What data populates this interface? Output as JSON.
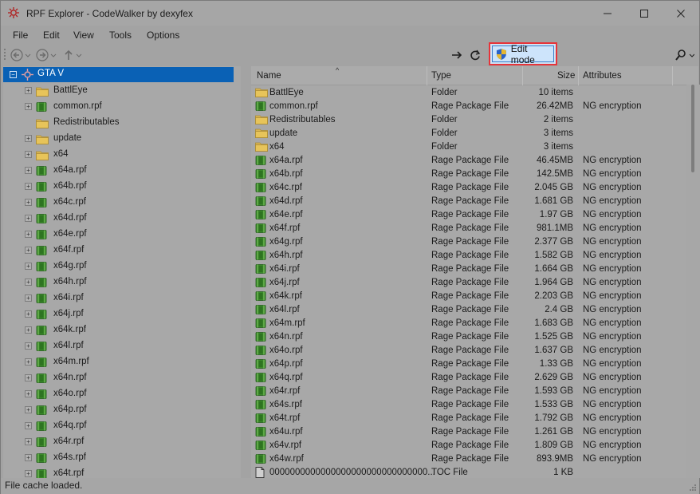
{
  "window": {
    "title": "RPF Explorer - CodeWalker by dexyfex",
    "minimize_icon": "minimize-icon",
    "maximize_icon": "maximize-icon",
    "close_icon": "close-icon"
  },
  "menu": {
    "items": [
      "File",
      "Edit",
      "View",
      "Tools",
      "Options"
    ]
  },
  "toolbar": {
    "edit_mode_label": "Edit mode"
  },
  "tree": {
    "root": "GTA V",
    "items": [
      {
        "label": "BattlEye",
        "type": "folder",
        "expandable": true
      },
      {
        "label": "common.rpf",
        "type": "rpf",
        "expandable": true
      },
      {
        "label": "Redistributables",
        "type": "folder",
        "expandable": false
      },
      {
        "label": "update",
        "type": "folder",
        "expandable": true
      },
      {
        "label": "x64",
        "type": "folder",
        "expandable": true
      },
      {
        "label": "x64a.rpf",
        "type": "rpf",
        "expandable": true
      },
      {
        "label": "x64b.rpf",
        "type": "rpf",
        "expandable": true
      },
      {
        "label": "x64c.rpf",
        "type": "rpf",
        "expandable": true
      },
      {
        "label": "x64d.rpf",
        "type": "rpf",
        "expandable": true
      },
      {
        "label": "x64e.rpf",
        "type": "rpf",
        "expandable": true
      },
      {
        "label": "x64f.rpf",
        "type": "rpf",
        "expandable": true
      },
      {
        "label": "x64g.rpf",
        "type": "rpf",
        "expandable": true
      },
      {
        "label": "x64h.rpf",
        "type": "rpf",
        "expandable": true
      },
      {
        "label": "x64i.rpf",
        "type": "rpf",
        "expandable": true
      },
      {
        "label": "x64j.rpf",
        "type": "rpf",
        "expandable": true
      },
      {
        "label": "x64k.rpf",
        "type": "rpf",
        "expandable": true
      },
      {
        "label": "x64l.rpf",
        "type": "rpf",
        "expandable": true
      },
      {
        "label": "x64m.rpf",
        "type": "rpf",
        "expandable": true
      },
      {
        "label": "x64n.rpf",
        "type": "rpf",
        "expandable": true
      },
      {
        "label": "x64o.rpf",
        "type": "rpf",
        "expandable": true
      },
      {
        "label": "x64p.rpf",
        "type": "rpf",
        "expandable": true
      },
      {
        "label": "x64q.rpf",
        "type": "rpf",
        "expandable": true
      },
      {
        "label": "x64r.rpf",
        "type": "rpf",
        "expandable": true
      },
      {
        "label": "x64s.rpf",
        "type": "rpf",
        "expandable": true
      },
      {
        "label": "x64t.rpf",
        "type": "rpf",
        "expandable": true
      }
    ]
  },
  "list": {
    "columns": [
      "Name",
      "Type",
      "Size",
      "Attributes"
    ],
    "rows": [
      {
        "name": "BattlEye",
        "type": "Folder",
        "size": "10 items",
        "attr": "",
        "icon": "folder"
      },
      {
        "name": "common.rpf",
        "type": "Rage Package File",
        "size": "26.42MB",
        "attr": "NG encryption",
        "icon": "rpf"
      },
      {
        "name": "Redistributables",
        "type": "Folder",
        "size": "2 items",
        "attr": "",
        "icon": "folder"
      },
      {
        "name": "update",
        "type": "Folder",
        "size": "3 items",
        "attr": "",
        "icon": "folder"
      },
      {
        "name": "x64",
        "type": "Folder",
        "size": "3 items",
        "attr": "",
        "icon": "folder"
      },
      {
        "name": "x64a.rpf",
        "type": "Rage Package File",
        "size": "46.45MB",
        "attr": "NG encryption",
        "icon": "rpf"
      },
      {
        "name": "x64b.rpf",
        "type": "Rage Package File",
        "size": "142.5MB",
        "attr": "NG encryption",
        "icon": "rpf"
      },
      {
        "name": "x64c.rpf",
        "type": "Rage Package File",
        "size": "2.045 GB",
        "attr": "NG encryption",
        "icon": "rpf"
      },
      {
        "name": "x64d.rpf",
        "type": "Rage Package File",
        "size": "1.681 GB",
        "attr": "NG encryption",
        "icon": "rpf"
      },
      {
        "name": "x64e.rpf",
        "type": "Rage Package File",
        "size": "1.97 GB",
        "attr": "NG encryption",
        "icon": "rpf"
      },
      {
        "name": "x64f.rpf",
        "type": "Rage Package File",
        "size": "981.1MB",
        "attr": "NG encryption",
        "icon": "rpf"
      },
      {
        "name": "x64g.rpf",
        "type": "Rage Package File",
        "size": "2.377 GB",
        "attr": "NG encryption",
        "icon": "rpf"
      },
      {
        "name": "x64h.rpf",
        "type": "Rage Package File",
        "size": "1.582 GB",
        "attr": "NG encryption",
        "icon": "rpf"
      },
      {
        "name": "x64i.rpf",
        "type": "Rage Package File",
        "size": "1.664 GB",
        "attr": "NG encryption",
        "icon": "rpf"
      },
      {
        "name": "x64j.rpf",
        "type": "Rage Package File",
        "size": "1.964 GB",
        "attr": "NG encryption",
        "icon": "rpf"
      },
      {
        "name": "x64k.rpf",
        "type": "Rage Package File",
        "size": "2.203 GB",
        "attr": "NG encryption",
        "icon": "rpf"
      },
      {
        "name": "x64l.rpf",
        "type": "Rage Package File",
        "size": "2.4 GB",
        "attr": "NG encryption",
        "icon": "rpf"
      },
      {
        "name": "x64m.rpf",
        "type": "Rage Package File",
        "size": "1.683 GB",
        "attr": "NG encryption",
        "icon": "rpf"
      },
      {
        "name": "x64n.rpf",
        "type": "Rage Package File",
        "size": "1.525 GB",
        "attr": "NG encryption",
        "icon": "rpf"
      },
      {
        "name": "x64o.rpf",
        "type": "Rage Package File",
        "size": "1.637 GB",
        "attr": "NG encryption",
        "icon": "rpf"
      },
      {
        "name": "x64p.rpf",
        "type": "Rage Package File",
        "size": "1.33 GB",
        "attr": "NG encryption",
        "icon": "rpf"
      },
      {
        "name": "x64q.rpf",
        "type": "Rage Package File",
        "size": "2.629 GB",
        "attr": "NG encryption",
        "icon": "rpf"
      },
      {
        "name": "x64r.rpf",
        "type": "Rage Package File",
        "size": "1.593 GB",
        "attr": "NG encryption",
        "icon": "rpf"
      },
      {
        "name": "x64s.rpf",
        "type": "Rage Package File",
        "size": "1.533 GB",
        "attr": "NG encryption",
        "icon": "rpf"
      },
      {
        "name": "x64t.rpf",
        "type": "Rage Package File",
        "size": "1.792 GB",
        "attr": "NG encryption",
        "icon": "rpf"
      },
      {
        "name": "x64u.rpf",
        "type": "Rage Package File",
        "size": "1.261 GB",
        "attr": "NG encryption",
        "icon": "rpf"
      },
      {
        "name": "x64v.rpf",
        "type": "Rage Package File",
        "size": "1.809 GB",
        "attr": "NG encryption",
        "icon": "rpf"
      },
      {
        "name": "x64w.rpf",
        "type": "Rage Package File",
        "size": "893.9MB",
        "attr": "NG encryption",
        "icon": "rpf"
      },
      {
        "name": "0000000000000000000000000000000...",
        "type": "TOC File",
        "size": "1 KB",
        "attr": "",
        "icon": "file"
      }
    ]
  },
  "status": {
    "text": "File cache loaded."
  },
  "colors": {
    "selection": "#0a61b5",
    "edit_highlight": "#e6343a",
    "rpf_green": "#3a8a2a",
    "folder_yellow": "#e7c45a"
  }
}
